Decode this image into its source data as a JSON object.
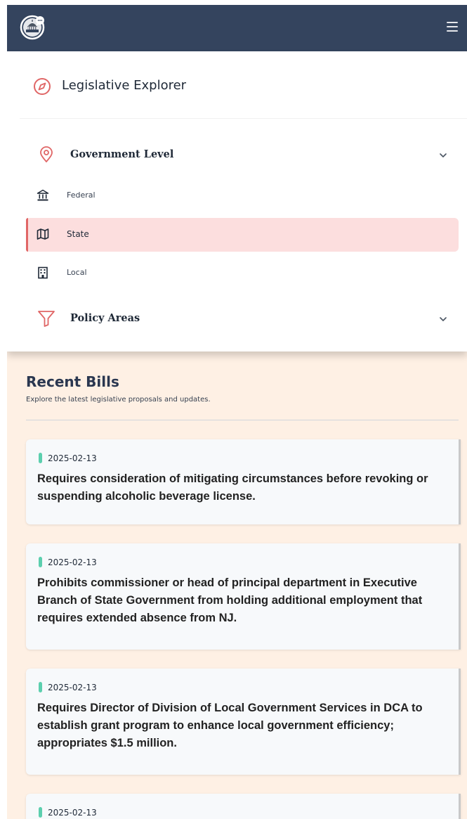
{
  "navbar": {
    "logo_icon": "capitol-chat-logo-icon",
    "menu_icon": "hamburger-menu-icon"
  },
  "sidebar": {
    "header": {
      "icon": "compass-icon",
      "title": "Legislative Explorer"
    },
    "government_level": {
      "icon": "map-pin-icon",
      "label": "Government Level",
      "expanded": true,
      "items": [
        {
          "label": "Federal",
          "icon": "landmark-icon",
          "active": false
        },
        {
          "label": "State",
          "icon": "map-icon",
          "active": true
        },
        {
          "label": "Local",
          "icon": "building-icon",
          "active": false
        }
      ]
    },
    "policy_areas": {
      "icon": "filter-icon",
      "label": "Policy Areas",
      "expanded": false
    }
  },
  "main": {
    "title": "Recent Bills",
    "subtitle": "Explore the latest legislative proposals and updates.",
    "bills": [
      {
        "date": "2025-02-13",
        "title": "Requires consideration of mitigating circumstances before revoking or suspending alcoholic beverage license."
      },
      {
        "date": "2025-02-13",
        "title": "Prohibits commissioner or head of principal department in Executive Branch of State Government from holding additional employment that requires extended absence from NJ."
      },
      {
        "date": "2025-02-13",
        "title": "Requires Director of Division of Local Government Services in DCA to establish grant program to enhance local government efficiency; appropriates $1.5 million."
      },
      {
        "date": "2025-02-13",
        "title": ""
      }
    ]
  },
  "colors": {
    "navbar": "#34445e",
    "accent_red": "#e06666",
    "active_bg": "#fcdede",
    "content_bg": "#fef0e4",
    "date_pill": "#5ccfae",
    "heading": "#2a3750"
  }
}
